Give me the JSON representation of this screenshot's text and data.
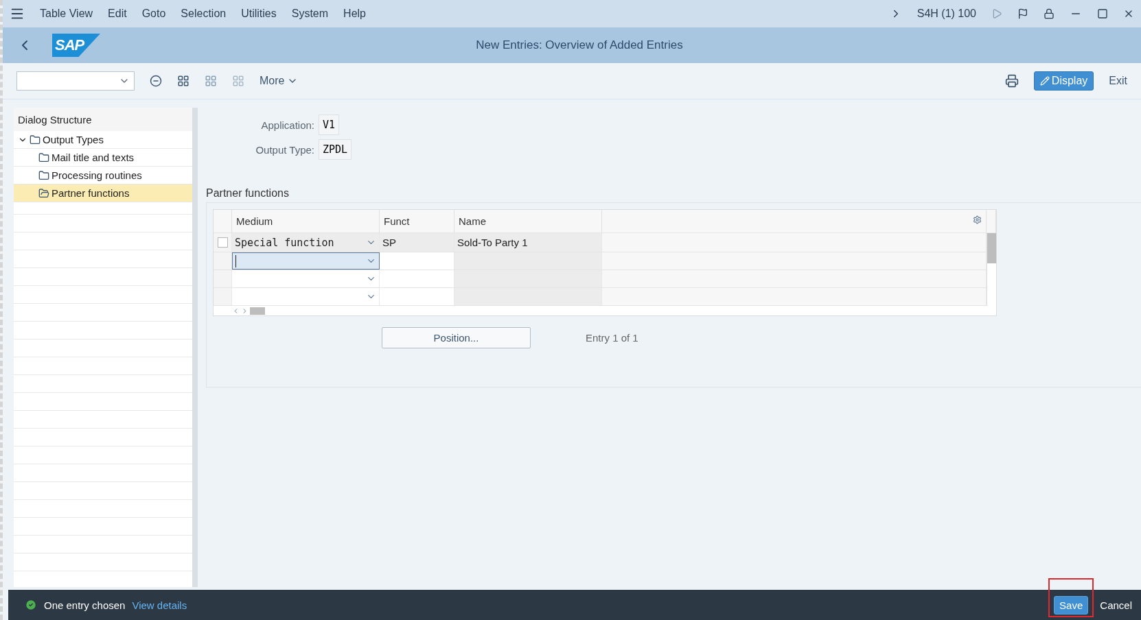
{
  "menu": {
    "items": [
      "Table View",
      "Edit",
      "Goto",
      "Selection",
      "Utilities",
      "System",
      "Help"
    ],
    "system_info": "S4H (1) 100"
  },
  "header": {
    "logo": "SAP",
    "title": "New Entries: Overview of Added Entries"
  },
  "toolbar": {
    "more": "More",
    "display": "Display",
    "exit": "Exit"
  },
  "sidebar": {
    "title": "Dialog Structure",
    "tree": [
      {
        "label": "Output Types",
        "expanded": true,
        "selected": false,
        "children": [
          {
            "label": "Mail title and texts",
            "selected": false
          },
          {
            "label": "Processing routines",
            "selected": false
          },
          {
            "label": "Partner functions",
            "selected": true
          }
        ]
      }
    ]
  },
  "fields": [
    {
      "label": "Application:",
      "value": "V1"
    },
    {
      "label": "Output Type:",
      "value": "ZPDL"
    }
  ],
  "section": {
    "title": "Partner functions"
  },
  "table": {
    "columns": [
      "Medium",
      "Funct",
      "Name"
    ],
    "rows": [
      {
        "medium": "Special function",
        "funct": "SP",
        "name": "Sold-To Party 1",
        "selected": false,
        "focused": false
      },
      {
        "focused": true
      },
      {
        "focused": false
      },
      {
        "focused": false
      }
    ]
  },
  "position_button": "Position...",
  "entry_info": "Entry 1 of 1",
  "status_bar": {
    "message": "One entry chosen",
    "link": "View details",
    "buttons": [
      {
        "label": "Save",
        "kind": "primary",
        "highlighted": true
      },
      {
        "label": "Cancel",
        "kind": "plain",
        "highlighted": false
      }
    ]
  }
}
